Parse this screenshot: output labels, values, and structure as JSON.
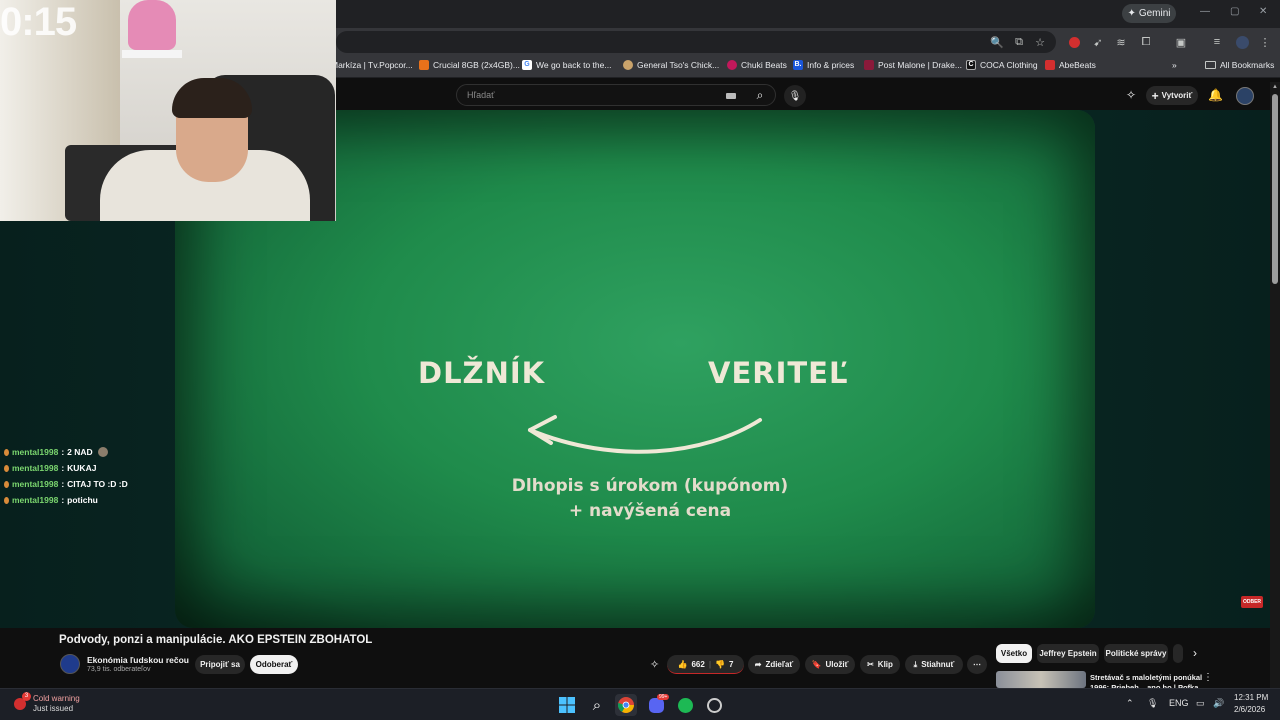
{
  "browser": {
    "gemini_label": "Gemini",
    "window_controls": [
      "—",
      "▢",
      "✕"
    ],
    "bookmarks": [
      {
        "label": "Markíza | Tv.Popcor...",
        "color": "#ffffff"
      },
      {
        "label": "Crucial 8GB (2x4GB)...",
        "color": "#e8711a"
      },
      {
        "label": "We go back to the...",
        "color": "#4285f4",
        "glyph": "G"
      },
      {
        "label": "General Tso's Chick...",
        "color": "#c9a36b"
      },
      {
        "label": "Chuki Beats",
        "color": "#c2185b"
      },
      {
        "label": "Info & prices",
        "color": "#1a56db",
        "glyph": "B."
      },
      {
        "label": "Post Malone | Drake...",
        "color": "#8b1a3a"
      },
      {
        "label": "COCA Clothing",
        "color": "#111111",
        "glyph": "C"
      },
      {
        "label": "AbeBeats",
        "color": "#d32f2f"
      }
    ],
    "all_bookmarks": "All Bookmarks"
  },
  "youtube": {
    "search_placeholder": "Hľadať",
    "create_label": "Vytvoriť"
  },
  "overlay": {
    "timer": "0:15",
    "chat": [
      {
        "nick": "mental1998",
        "message": "2 NAD"
      },
      {
        "nick": "mental1998",
        "message": "KUKAJ"
      },
      {
        "nick": "mental1998",
        "message": "CITAJ TO :D :D"
      },
      {
        "nick": "mental1998",
        "message": "potichu"
      }
    ]
  },
  "video_frame": {
    "left_word": "DLŽNÍK",
    "right_word": "VERITEĽ",
    "line1": "Dlhopis s úrokom (kupónom)",
    "line2": "+ navýšená cena",
    "subscribe_badge": "ODBER"
  },
  "video_info": {
    "title": "Podvody, ponzi a manipulácie. AKO EPSTEIN ZBOHATOL",
    "channel": "Ekonómia ľudskou rečou",
    "subscribers": "73,9 tis. odberateľov",
    "join_label": "Pripojiť sa",
    "subscribe_label": "Odoberať",
    "likes": "662",
    "dislikes": "7",
    "share_label": "Zdieľať",
    "save_label": "Uložiť",
    "clip_label": "Klip",
    "download_label": "Stiahnuť"
  },
  "sidebar": {
    "chips": [
      "Všetko",
      "Jeffrey Epstein",
      "Politické správy"
    ],
    "rec_title": "Stretávač s maloletými ponúkal",
    "rec_title2": "1996: Priebeh...  ano ho | Pofka"
  },
  "taskbar": {
    "notification_title": "Cold warning",
    "notification_sub": "Just issued",
    "notification_badge": "3",
    "discord_badge": "99+",
    "lang": "ENG",
    "time": "12:31 PM",
    "date": "2/6/2026"
  }
}
